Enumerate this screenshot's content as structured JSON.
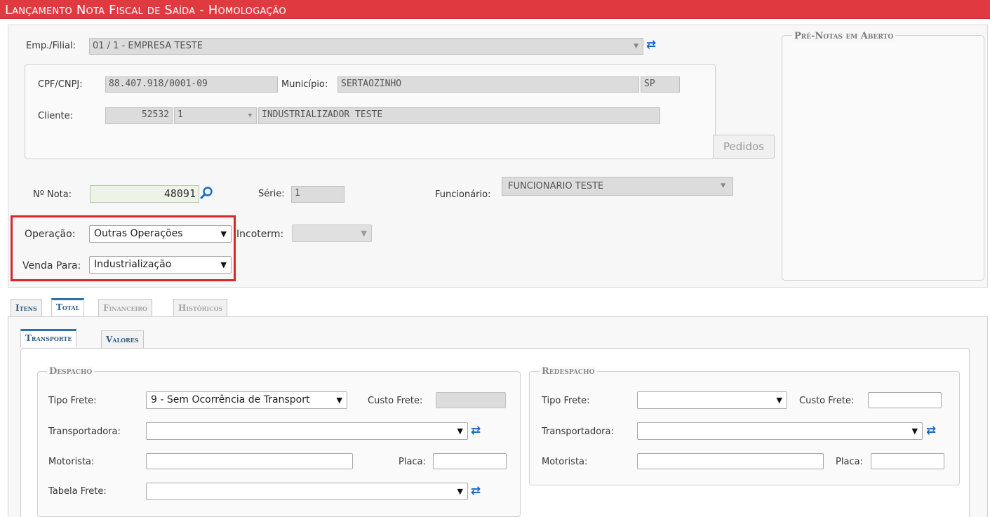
{
  "window": {
    "title": "Lançamento Nota Fiscal de Saída  - Homologação"
  },
  "header": {
    "empresa_label": "Emp./Filial:",
    "empresa_value": "01 / 1 - EMPRESA TESTE",
    "cpf_label": "CPF/CNPJ:",
    "cpf_value": "88.407.918/0001-09",
    "municipio_label": "Município:",
    "municipio_value": "SERTAOZINHO",
    "uf_value": "SP",
    "cliente_label": "Cliente:",
    "cliente_code": "52532",
    "cliente_loja": "1",
    "cliente_name": "INDUSTRIALIZADOR TESTE",
    "pedidos_button": "Pedidos",
    "nota_label": "Nº Nota:",
    "nota_value": "48091",
    "serie_label": "Série:",
    "serie_value": "1",
    "funcionario_label": "Funcionário:",
    "funcionario_value": "FUNCIONARIO TESTE",
    "operacao_label": "Operação:",
    "operacao_value": "Outras Operações",
    "incoterm_label": "Incoterm:",
    "incoterm_value": "",
    "venda_label": "Venda Para:",
    "venda_value": "Industrialização"
  },
  "pre_notas": {
    "legend": "Pré-Notas em Aberto"
  },
  "main_tabs": [
    {
      "label": "Itens",
      "state": "normal"
    },
    {
      "label": "Total",
      "state": "active"
    },
    {
      "label": "Financeiro",
      "state": "disabled"
    },
    {
      "label": "Históricos",
      "state": "disabled"
    }
  ],
  "sub_tabs": [
    {
      "label": "Transporte",
      "state": "active"
    },
    {
      "label": "Valores",
      "state": "normal"
    }
  ],
  "despacho": {
    "legend": "Despacho",
    "tipo_frete_label": "Tipo Frete:",
    "tipo_frete_value": "9 - Sem Ocorrência de Transport",
    "custo_frete_label": "Custo Frete:",
    "transportadora_label": "Transportadora:",
    "motorista_label": "Motorista:",
    "placa_label": "Placa:",
    "tabela_frete_label": "Tabela Frete:"
  },
  "redespacho": {
    "legend": "Redespacho",
    "tipo_frete_label": "Tipo Frete:",
    "tipo_frete_value": "",
    "custo_frete_label": "Custo Frete:",
    "transportadora_label": "Transportadora:",
    "motorista_label": "Motorista:",
    "placa_label": "Placa:"
  },
  "colors": {
    "title_bar": "#e03a40",
    "tab_accent": "#2f6fa8",
    "refresh_icon": "#1d67c9",
    "highlight_box": "#d9252b"
  },
  "icons": [
    "refresh-icon",
    "search-icon",
    "chevron-down-icon"
  ]
}
